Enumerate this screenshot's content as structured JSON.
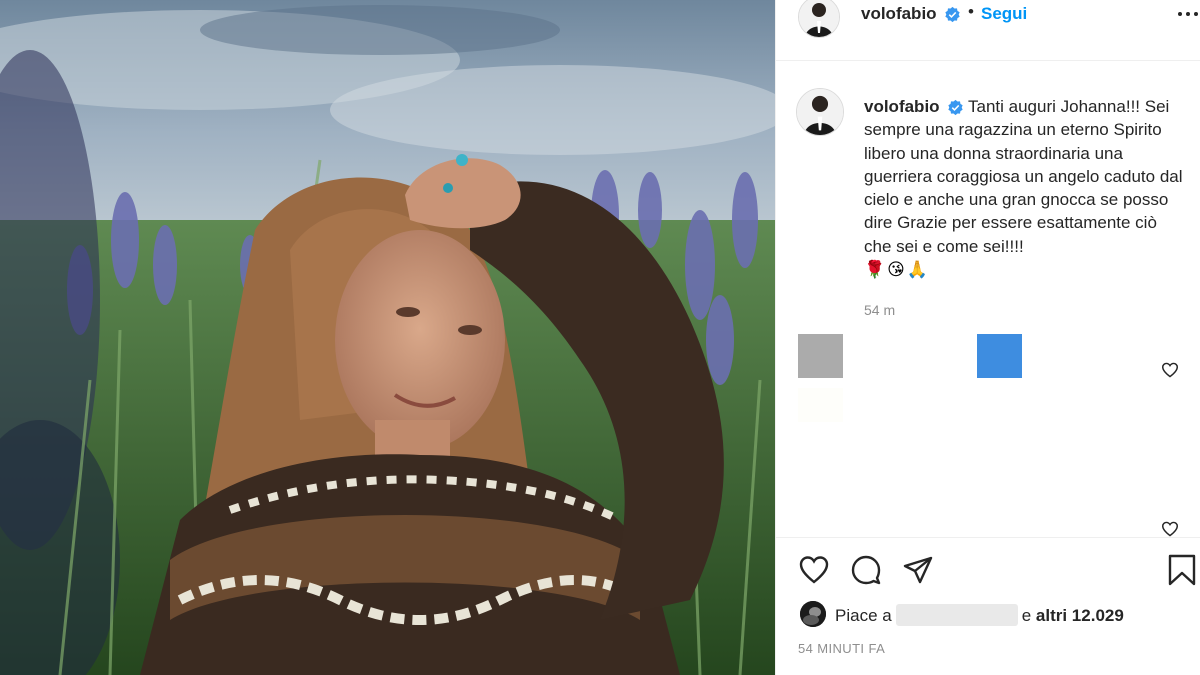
{
  "post": {
    "username": "volofabio",
    "verified": true,
    "follow_separator": "•",
    "follow_label": "Segui"
  },
  "caption": {
    "username": "volofabio",
    "text": "Tanti auguri Johanna!!! Sei sempre una ragazzina un eterno Spirito libero una donna straordinaria una guerriera coraggiosa un angelo caduto dal cielo e anche una gran gnocca se posso dire Grazie per essere esattamente ciò che sei e come sei!!!!",
    "emojis": "🌹😘🙏",
    "time": "54 m"
  },
  "likes": {
    "prefix": "Piace a",
    "connector": "e",
    "others": "altri 12.029"
  },
  "timestamp": "54 MINUTI FA",
  "icons": {
    "like": "heart-icon",
    "comment": "comment-icon",
    "share": "share-icon",
    "save": "bookmark-icon",
    "more": "more-options-icon",
    "verified": "verified-badge-icon"
  },
  "colors": {
    "link": "#0095f6",
    "verified": "#3897f0",
    "text": "#262626",
    "muted": "#8e8e8e"
  }
}
